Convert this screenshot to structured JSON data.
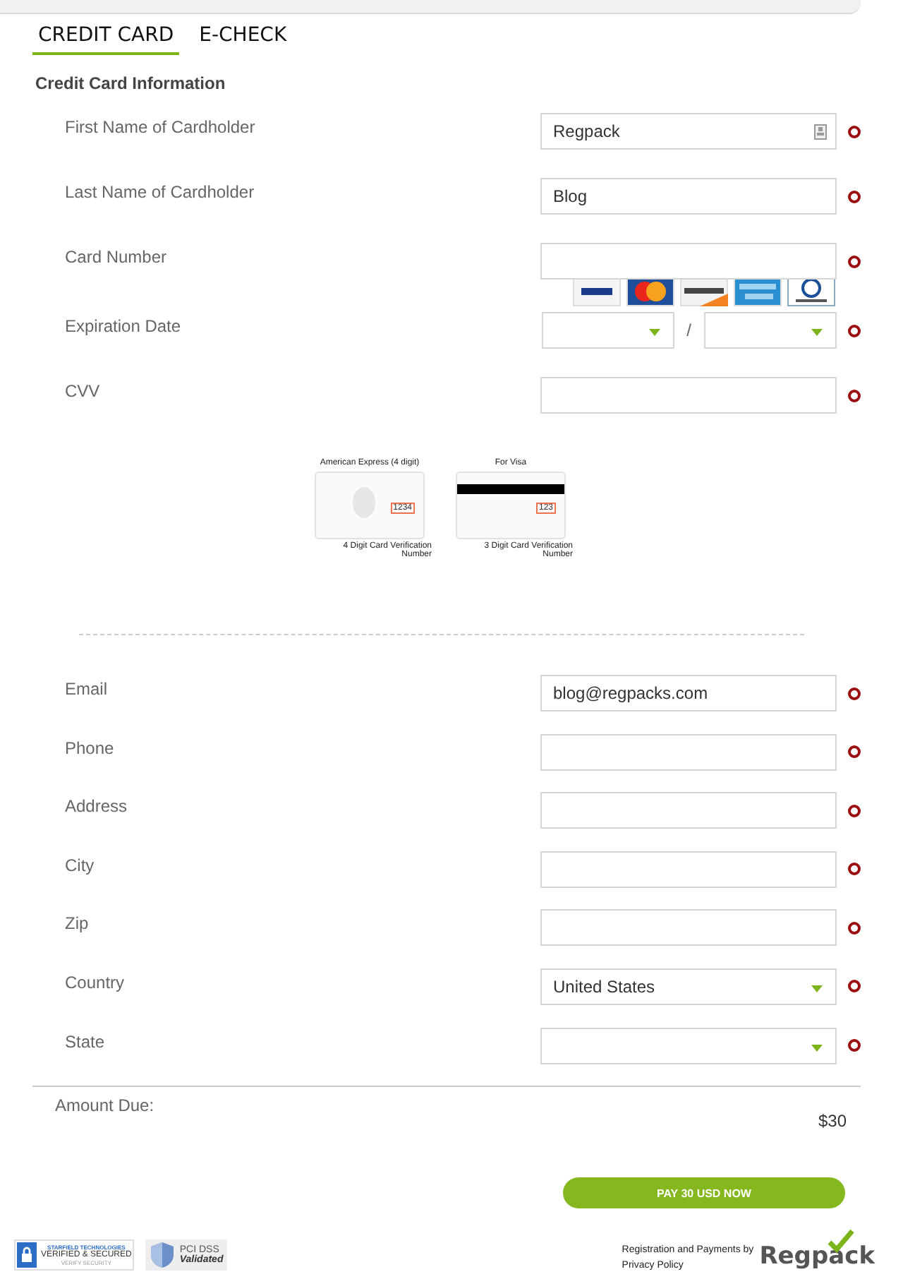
{
  "tabs": [
    {
      "label": "CREDIT CARD",
      "selected": true
    },
    {
      "label": "E-CHECK",
      "selected": false
    }
  ],
  "section_title": "Credit Card Information",
  "card_fields": [
    {
      "label": "First Name of Cardholder",
      "kind": "text",
      "value": "Regpack",
      "required": true,
      "autofill_icon": true
    },
    {
      "label": "Last Name of Cardholder",
      "kind": "text",
      "value": "Blog",
      "required": true
    },
    {
      "label": "Card Number",
      "kind": "cards",
      "required": true
    },
    {
      "label": "Expiration Date",
      "kind": "date",
      "separator": "/",
      "required": true
    },
    {
      "label": "CVV",
      "kind": "text",
      "required": true
    }
  ],
  "cvv_help": [
    {
      "caption": "American Express (4 digit)",
      "code": "1234",
      "note": "4 Digit Card Verification Number",
      "kind": "front"
    },
    {
      "caption": "For Visa",
      "code": "123",
      "note": "3 Digit Card Verification Number",
      "kind": "back"
    }
  ],
  "contact_fields": [
    {
      "label": "Email",
      "kind": "text",
      "value": "blog@regpacks.com",
      "required": true
    },
    {
      "label": "Phone",
      "kind": "text",
      "required": true
    },
    {
      "label": "Address",
      "kind": "text",
      "required": true
    },
    {
      "label": "City",
      "kind": "text",
      "required": true
    },
    {
      "label": "Zip",
      "kind": "text",
      "required": true
    },
    {
      "label": "Country",
      "kind": "select",
      "value": "United States",
      "required": true
    },
    {
      "label": "State",
      "kind": "select",
      "required": true
    }
  ],
  "amount_due": {
    "label": "Amount Due:",
    "value": "$30"
  },
  "pay_button": "PAY 30 USD NOW",
  "footer": {
    "seal": {
      "top": "STARFIELD TECHNOLOGIES",
      "main": "VERIFIED & SECURED",
      "bottom": "VERIFY SECURITY"
    },
    "pci": {
      "top": "PCI DSS",
      "bottom": "Validated"
    },
    "powered_by": "Registration and Payments by",
    "privacy": "Privacy Policy",
    "logo": "Regpack"
  }
}
